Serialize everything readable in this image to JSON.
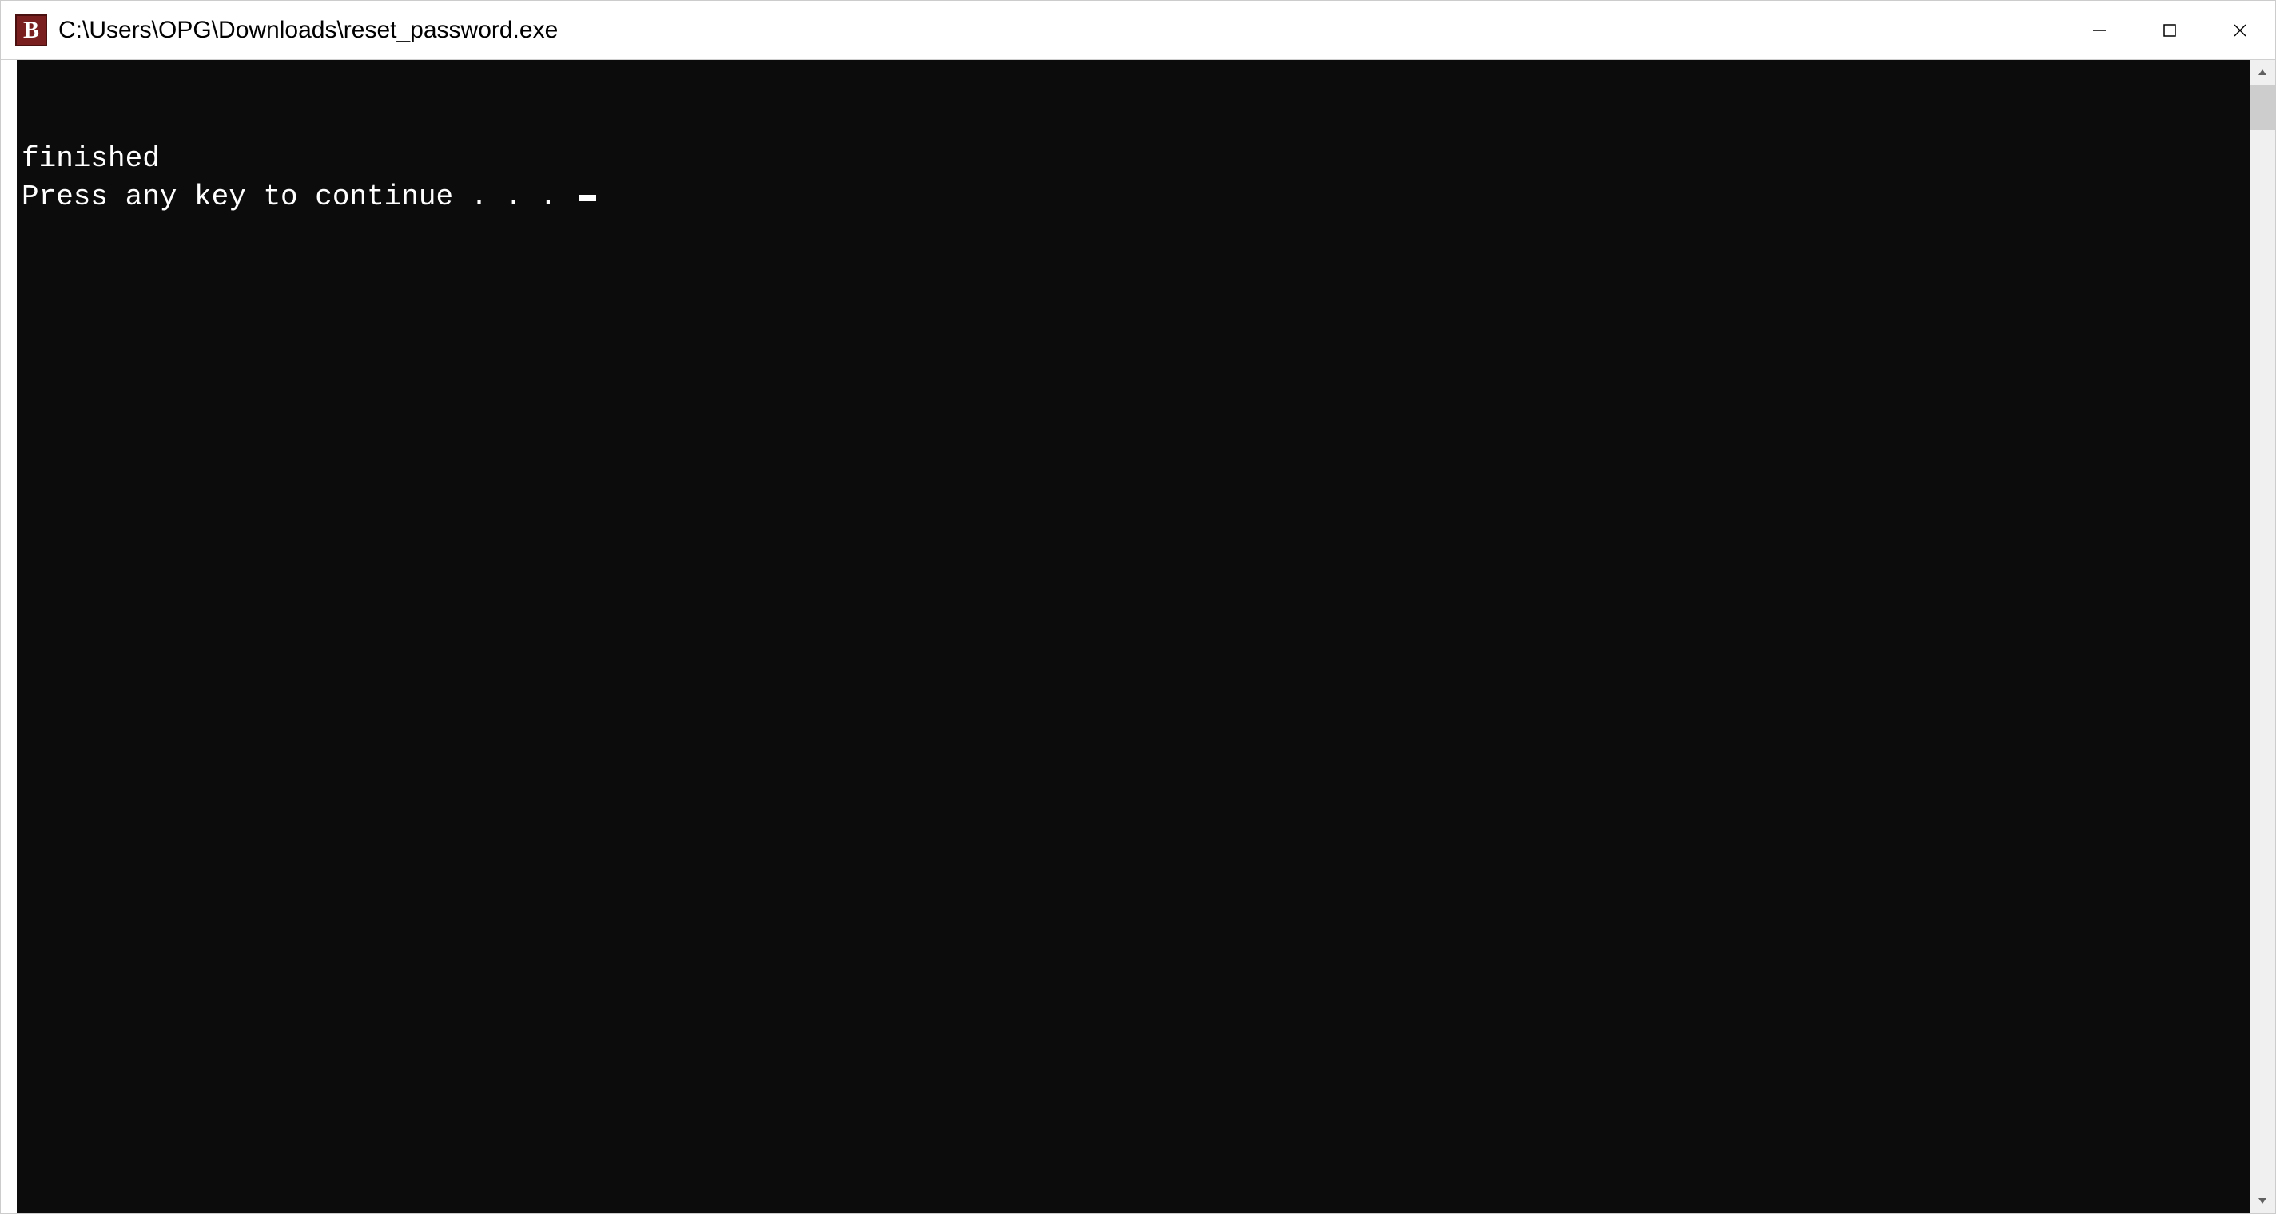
{
  "window": {
    "icon_letter": "B",
    "title": "C:\\Users\\OPG\\Downloads\\reset_password.exe"
  },
  "console": {
    "lines": [
      "finished",
      "Press any key to continue . . . "
    ]
  }
}
